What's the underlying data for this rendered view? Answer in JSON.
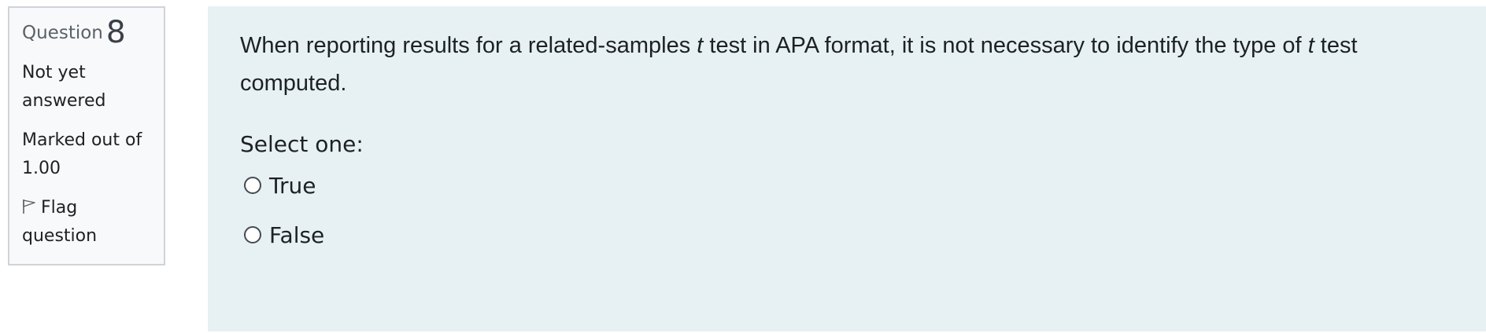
{
  "info": {
    "question_label": "Question",
    "question_number": "8",
    "state": "Not yet answered",
    "grade": "Marked out of 1.00",
    "flag_label": "Flag question"
  },
  "question": {
    "text_part1": "When reporting results for a related-samples ",
    "text_italic1": "t",
    "text_part2": " test in APA format, it is not necessary to identify the type of ",
    "text_italic2": "t",
    "text_part3": " test computed.",
    "prompt": "Select one:",
    "options": [
      {
        "label": "True",
        "selected": false
      },
      {
        "label": "False",
        "selected": false
      }
    ]
  },
  "colors": {
    "content_bg": "#e7f1f4",
    "info_bg": "#f8f9fa",
    "info_border": "#cfd4da"
  },
  "icons": {
    "flag": "flag-icon",
    "radio": "radio-unchecked-icon"
  }
}
